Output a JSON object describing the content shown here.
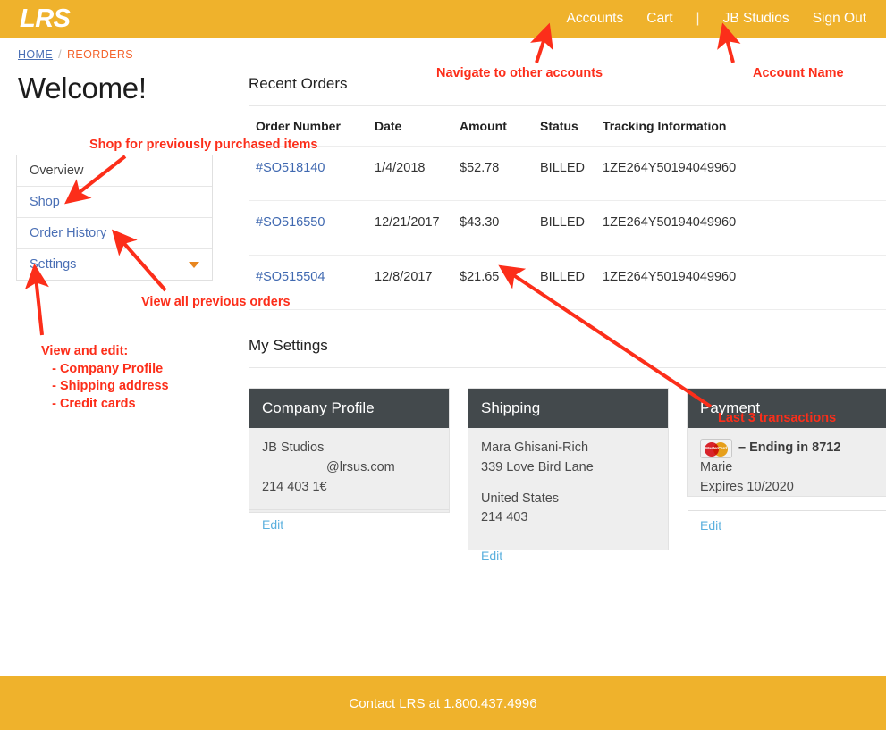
{
  "header": {
    "logo": "LRS",
    "nav": [
      {
        "label": "Accounts",
        "name": "nav-accounts"
      },
      {
        "label": "Cart",
        "name": "nav-cart"
      },
      {
        "label": "|",
        "name": "nav-separator"
      },
      {
        "label": "JB Studios",
        "name": "nav-account-name"
      },
      {
        "label": "Sign Out",
        "name": "nav-sign-out"
      }
    ],
    "colors": {
      "background": "#efb22c",
      "text": "#ffffff"
    }
  },
  "breadcrumb": {
    "home": "HOME",
    "separator": "/",
    "current": "REORDERS"
  },
  "page_title": "Welcome!",
  "sidebar": {
    "items": [
      {
        "label": "Overview",
        "active": true
      },
      {
        "label": "Shop",
        "active": false
      },
      {
        "label": "Order History",
        "active": false
      },
      {
        "label": "Settings",
        "active": false,
        "caret": "chevron-down-icon"
      }
    ]
  },
  "recent_orders": {
    "title": "Recent Orders",
    "columns": [
      "Order Number",
      "Date",
      "Amount",
      "Status",
      "Tracking Information"
    ],
    "rows": [
      {
        "order_number": "#SO518140",
        "date": "1/4/2018",
        "amount": "$52.78",
        "status": "BILLED",
        "tracking": "1ZE264Y50194049960"
      },
      {
        "order_number": "#SO516550",
        "date": "12/21/2017",
        "amount": "$43.30",
        "status": "BILLED",
        "tracking": "1ZE264Y50194049960"
      },
      {
        "order_number": "#SO515504",
        "date": "12/8/2017",
        "amount": "$21.65",
        "status": "BILLED",
        "tracking": "1ZE264Y50194049960"
      }
    ]
  },
  "my_settings": {
    "title": "My Settings",
    "cards": [
      {
        "heading": "Company Profile",
        "line1": "JB Studios",
        "line2": "@lrsus.com",
        "line3": "214 403 1€",
        "edit": "Edit"
      },
      {
        "heading": "Shipping",
        "line1": "Mara Ghisani-Rich",
        "line2": "339 Love Bird Lane",
        "line3": "United States",
        "line4": "214 403",
        "edit": "Edit"
      },
      {
        "heading": "Payment",
        "card_brand_icon": "mastercard-icon",
        "card_brand_text": "MasterCard",
        "line1": "– Ending in 8712",
        "line2": "Marie",
        "line3": "Expires 10/2020",
        "edit": "Edit"
      }
    ]
  },
  "footer": {
    "text": "Contact LRS at 1.800.437.4996"
  },
  "annotations": {
    "color": "#fc2e1a",
    "items": [
      {
        "name": "annotation-navigate-accounts",
        "text": "Navigate to other accounts"
      },
      {
        "name": "annotation-account-name",
        "text": "Account Name"
      },
      {
        "name": "annotation-shop",
        "text": "Shop for previously purchased items"
      },
      {
        "name": "annotation-order-history",
        "text": "View all previous orders"
      },
      {
        "name": "annotation-settings",
        "text": "View and edit:\n   - Company Profile\n   - Shipping address\n   - Credit cards"
      },
      {
        "name": "annotation-transactions",
        "text": "Last 3 transactions"
      }
    ]
  }
}
